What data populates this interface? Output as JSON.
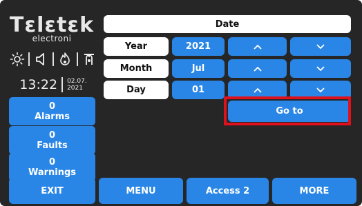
{
  "brand": {
    "name": "Tεlεtεk",
    "sub": "electroni"
  },
  "status_icons": [
    "sun-icon",
    "speaker-icon",
    "flame-icon",
    "fire-alarm-icon"
  ],
  "clock": {
    "time": "13:22",
    "date_line1": "02.07.",
    "date_line2": "2021"
  },
  "side": {
    "alarms": {
      "count": "0",
      "label": "Alarms"
    },
    "faults": {
      "count": "0",
      "label": "Faults"
    },
    "warnings": {
      "count": "0",
      "label": "Warnings"
    }
  },
  "date_panel": {
    "title": "Date",
    "year": {
      "label": "Year",
      "value": "2021"
    },
    "month": {
      "label": "Month",
      "value": "Jul"
    },
    "day": {
      "label": "Day",
      "value": "01"
    },
    "up_icon": "chevron-up-icon",
    "down_icon": "chevron-down-icon",
    "goto": "Go to"
  },
  "bottom": {
    "exit": "EXIT",
    "menu": "MENU",
    "access": "Access 2",
    "more": "MORE"
  },
  "colors": {
    "background": "#262626",
    "button": "#2a86e6",
    "highlight": "#e0101c",
    "label_bg": "#ffffff"
  }
}
